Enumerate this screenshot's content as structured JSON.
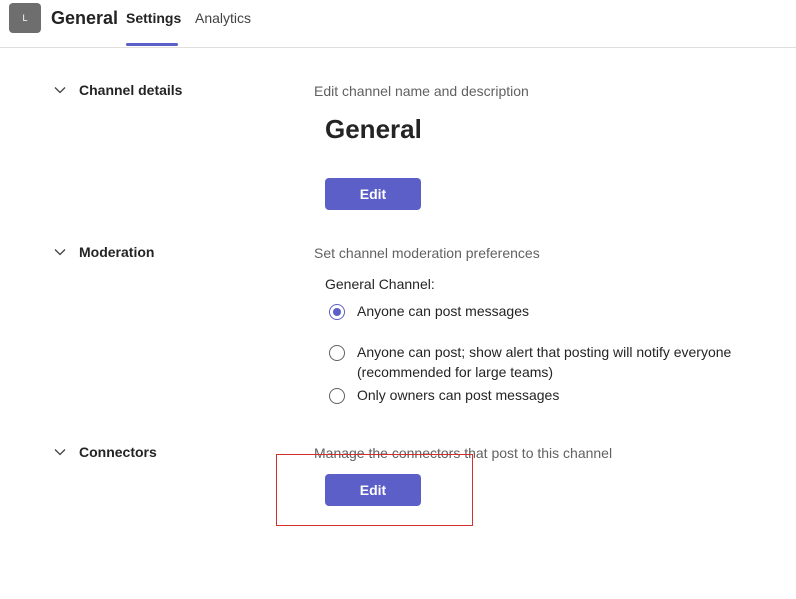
{
  "header": {
    "avatar_initial": "L",
    "channel_name": "General",
    "tabs": [
      {
        "label": "Settings",
        "active": true
      },
      {
        "label": "Analytics",
        "active": false
      }
    ]
  },
  "sections": {
    "channel_details": {
      "title": "Channel details",
      "description": "Edit channel name and description",
      "channel_name": "General",
      "edit_label": "Edit"
    },
    "moderation": {
      "title": "Moderation",
      "description": "Set channel moderation preferences",
      "group_label": "General Channel:",
      "options": [
        {
          "label": "Anyone can post messages",
          "selected": true
        },
        {
          "label": "Anyone can post; show alert that posting will notify everyone (recommended for large teams)",
          "selected": false
        },
        {
          "label": "Only owners can post messages",
          "selected": false
        }
      ]
    },
    "connectors": {
      "title": "Connectors",
      "description": "Manage the connectors that post to this channel",
      "edit_label": "Edit"
    }
  },
  "colors": {
    "accent": "#5b5fc7",
    "highlight": "#d32f2f"
  }
}
